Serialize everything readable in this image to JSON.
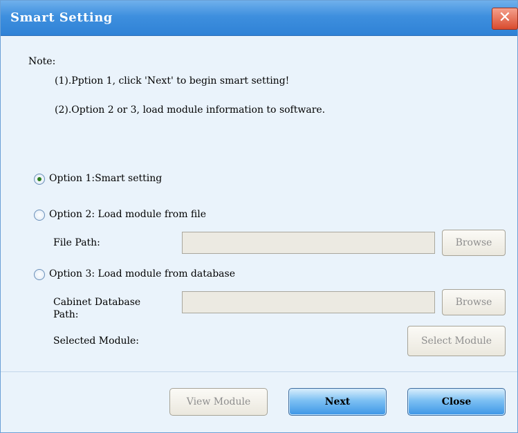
{
  "window": {
    "title": "Smart Setting",
    "close_glyph": "✕"
  },
  "note": {
    "heading": "Note:",
    "line1": "(1).Pption 1, click 'Next' to begin smart setting!",
    "line2": "(2).Option 2 or 3, load module information to software."
  },
  "options": {
    "opt1_label": "Option 1:Smart setting",
    "opt1_selected": true,
    "opt2_label": "Option 2: Load module from file",
    "opt2_selected": false,
    "opt3_label": "Option 3: Load module from database",
    "opt3_selected": false
  },
  "file_path": {
    "label": "File Path:",
    "value": "",
    "browse_label": "Browse"
  },
  "cabinet_db": {
    "label_line1": "Cabinet Database",
    "label_line2": "Path:",
    "value": "",
    "browse_label": "Browse"
  },
  "selected_module": {
    "label": "Selected Module:",
    "button_label": "Select Module"
  },
  "footer": {
    "view_module_label": "View Module",
    "next_label": "Next",
    "close_label": "Close"
  }
}
